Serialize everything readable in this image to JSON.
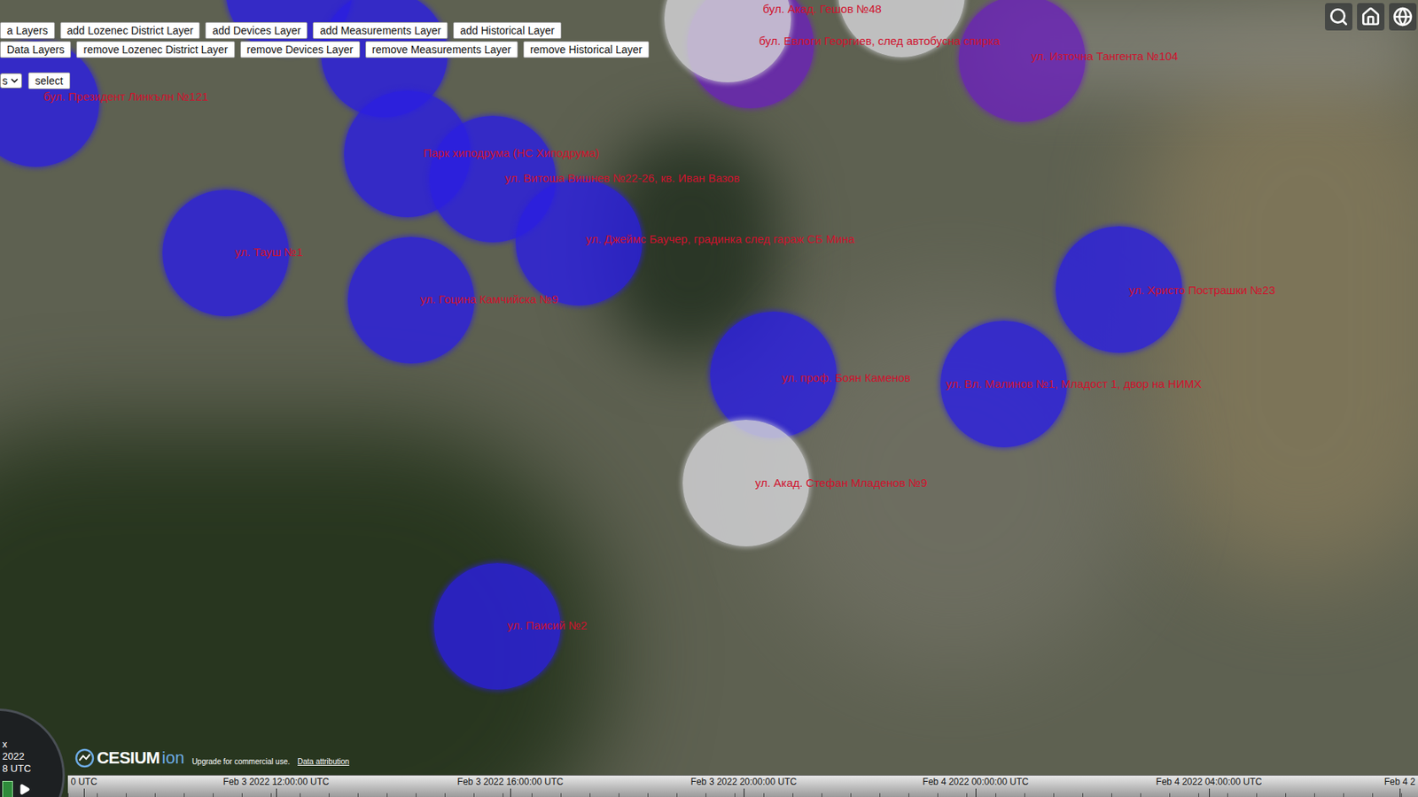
{
  "toolbar": {
    "add_buttons": [
      "a Layers",
      "add Lozenec District Layer",
      "add Devices Layer",
      "add Measurements Layer",
      "add Historical Layer"
    ],
    "remove_buttons": [
      "Data Layers",
      "remove Lozenec District Layer",
      "remove Devices Layer",
      "remove Measurements Layer",
      "remove Historical Layer"
    ],
    "select": {
      "value": "s"
    },
    "select_button": "select"
  },
  "markers": [
    {
      "color": "#2b1ee0",
      "label": "бул. Президент Линкълн №121"
    },
    {
      "color": "#2b1ee0"
    },
    {
      "color": "#2b1ee0"
    },
    {
      "color": "#2b1ee0",
      "label": "Парк хиподрума (НС Хиподрума)"
    },
    {
      "color": "#2b1ee0",
      "label": "ул. Витоша Вишнев №22-26, кв. Иван Вазов"
    },
    {
      "color": "#2b1ee0",
      "label": "ул. Джеймс Баучер, градинка след гараж СБ Мина"
    },
    {
      "color": "#2b1ee0",
      "label": "ул. Тауш №1"
    },
    {
      "color": "#2b1ee0",
      "label": "ул. Гоцина Камчийска №9"
    },
    {
      "color": "#6a22b8",
      "label": "бул. Евлоги Георгиев, след автобусна спирка"
    },
    {
      "color": "#d4d4d8",
      "label": "бул. Акад. Гешов №48"
    },
    {
      "color": "#d4d4d8"
    },
    {
      "color": "#6a22b8",
      "label": "ул. Източна Тангента №104"
    },
    {
      "color": "#2b1ee0",
      "label": "ул. Христо Пострашки №23"
    },
    {
      "color": "#2b1ee0",
      "label": "ул. проф. Боян Каменов"
    },
    {
      "color": "#2b1ee0",
      "label": "ул. Вл. Малинов №1, Младост 1, двор на НИМХ"
    },
    {
      "color": "#d4d4d8",
      "label": "ул. Акад. Стефан Младенов №9"
    },
    {
      "color": "#2b1ee0",
      "label": "ул. Паисий №2"
    }
  ],
  "animation": {
    "speed": "x",
    "date": "2022",
    "time": "8 UTC"
  },
  "timeline": {
    "ticks": [
      "0 UTC",
      "Feb 3 2022 12:00:00 UTC",
      "Feb 3 2022 16:00:00 UTC",
      "Feb 3 2022 20:00:00 UTC",
      "Feb 4 2022 00:00:00 UTC",
      "Feb 4 2022 04:00:00 UTC",
      "Feb 4 2"
    ]
  },
  "credits": {
    "logo": "CESIUM",
    "logo_suffix": "ion",
    "upgrade": "Upgrade for commercial use.",
    "attribution": "Data attribution"
  }
}
